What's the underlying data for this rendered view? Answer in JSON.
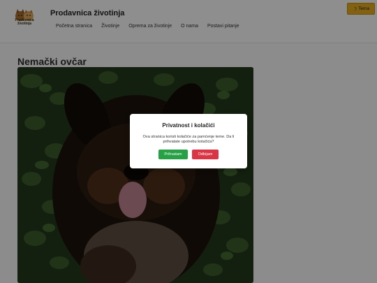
{
  "header": {
    "logo_text": "Prodavnica životinja",
    "site_title": "Prodavnica životinja",
    "nav": [
      "Početna stranica",
      "Životinje",
      "Oprema za životinje",
      "O nama",
      "Postavi pitanje"
    ],
    "theme_button": {
      "icon": "moon-icon",
      "label": "Tema"
    }
  },
  "main": {
    "title": "Nemački ovčar",
    "image": {
      "subject": "german-shepherd-puppy-photo"
    }
  },
  "cookie_dialog": {
    "title": "Privatnost i kolačići",
    "text": "Ova stranica koristi kolačiće za pamćenje teme. Da li prihvatate upotrebu kolačića?",
    "accept_label": "Prihvatam",
    "decline_label": "Odbijam"
  },
  "colors": {
    "accent": "#e0a81f",
    "accept": "#27a046",
    "decline": "#d93545"
  }
}
